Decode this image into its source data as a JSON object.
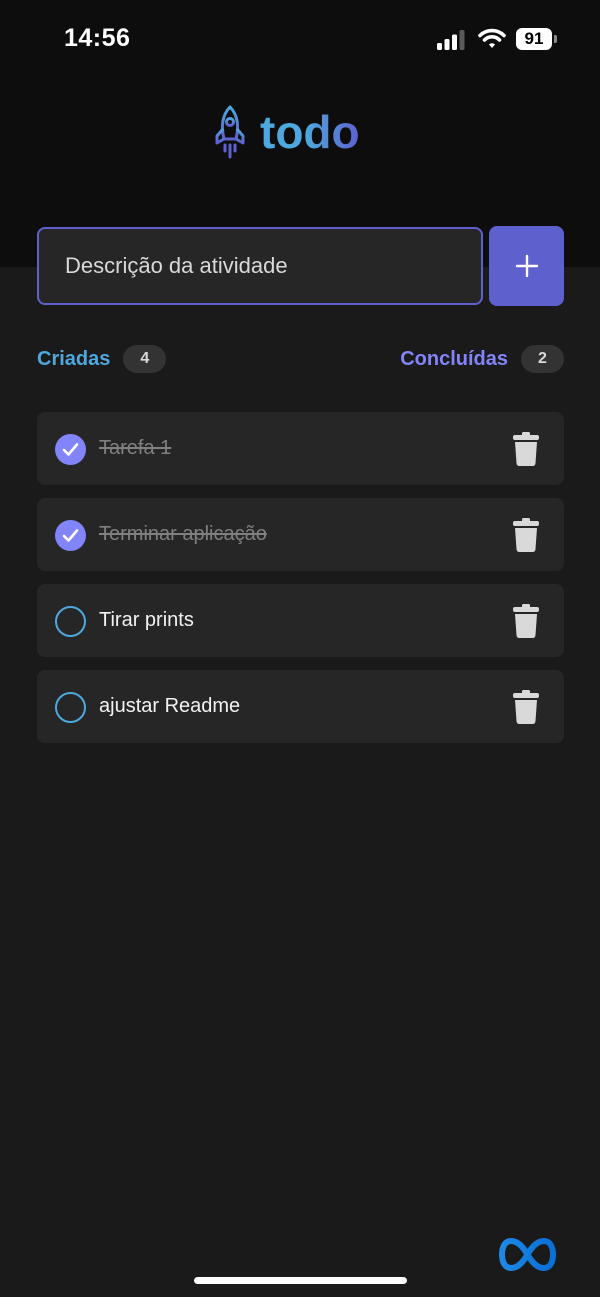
{
  "status_bar": {
    "time": "14:56",
    "battery": "91"
  },
  "logo": {
    "text": "todo",
    "icon": "rocket-icon"
  },
  "new_task": {
    "placeholder": "Descrição da atividade",
    "value": "",
    "add_button_icon": "plus-icon"
  },
  "counters": {
    "created_label": "Criadas",
    "created_count": "4",
    "done_label": "Concluídas",
    "done_count": "2"
  },
  "tasks": [
    {
      "text": "Tarefa 1",
      "done": true
    },
    {
      "text": "Terminar aplicação",
      "done": true
    },
    {
      "text": "Tirar prints",
      "done": false
    },
    {
      "text": "ajustar Readme",
      "done": false
    }
  ],
  "colors": {
    "background": "#1a1a1a",
    "header_background": "#0d0d0d",
    "accent_blue": "#4ea8de",
    "accent_purple": "#5e60ce",
    "purple_light": "#8284fa",
    "card": "#262626",
    "badge": "#333333",
    "muted_text": "#808080"
  }
}
